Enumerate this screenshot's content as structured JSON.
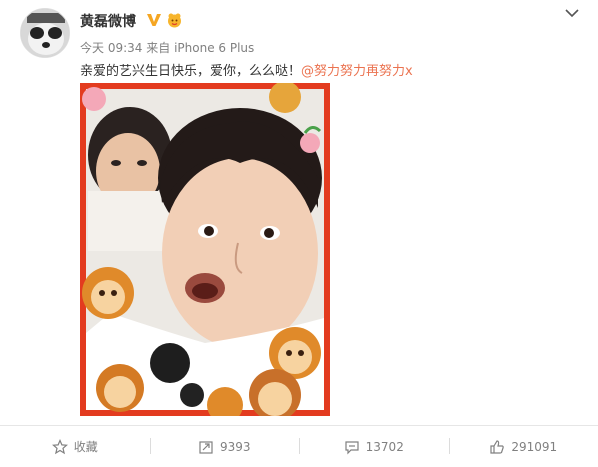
{
  "post": {
    "author": {
      "name": "黄磊微博",
      "verified_badge_icon": "verified-v-icon",
      "member_badge_icon": "vip-member-icon"
    },
    "menu_icon": "chevron-down-icon",
    "meta": {
      "time": "今天 09:34",
      "source_prefix": "来自",
      "source": "iPhone 6 Plus"
    },
    "text": "亲爱的艺兴生日快乐，爱你，么么哒！",
    "mention": "@努力努力再努力x",
    "image": {
      "alt": "selfie-photo"
    }
  },
  "actions": [
    {
      "label": "收藏",
      "icon": "star-icon"
    },
    {
      "label": "9393",
      "icon": "repost-icon"
    },
    {
      "label": "13702",
      "icon": "comment-icon"
    },
    {
      "label": "291091",
      "icon": "thumbs-up-icon"
    }
  ],
  "colors": {
    "mention": "#eb7350",
    "verified_badge": "#f5a623",
    "photo_frame": "#e33b1f",
    "muted_text": "#808080"
  }
}
